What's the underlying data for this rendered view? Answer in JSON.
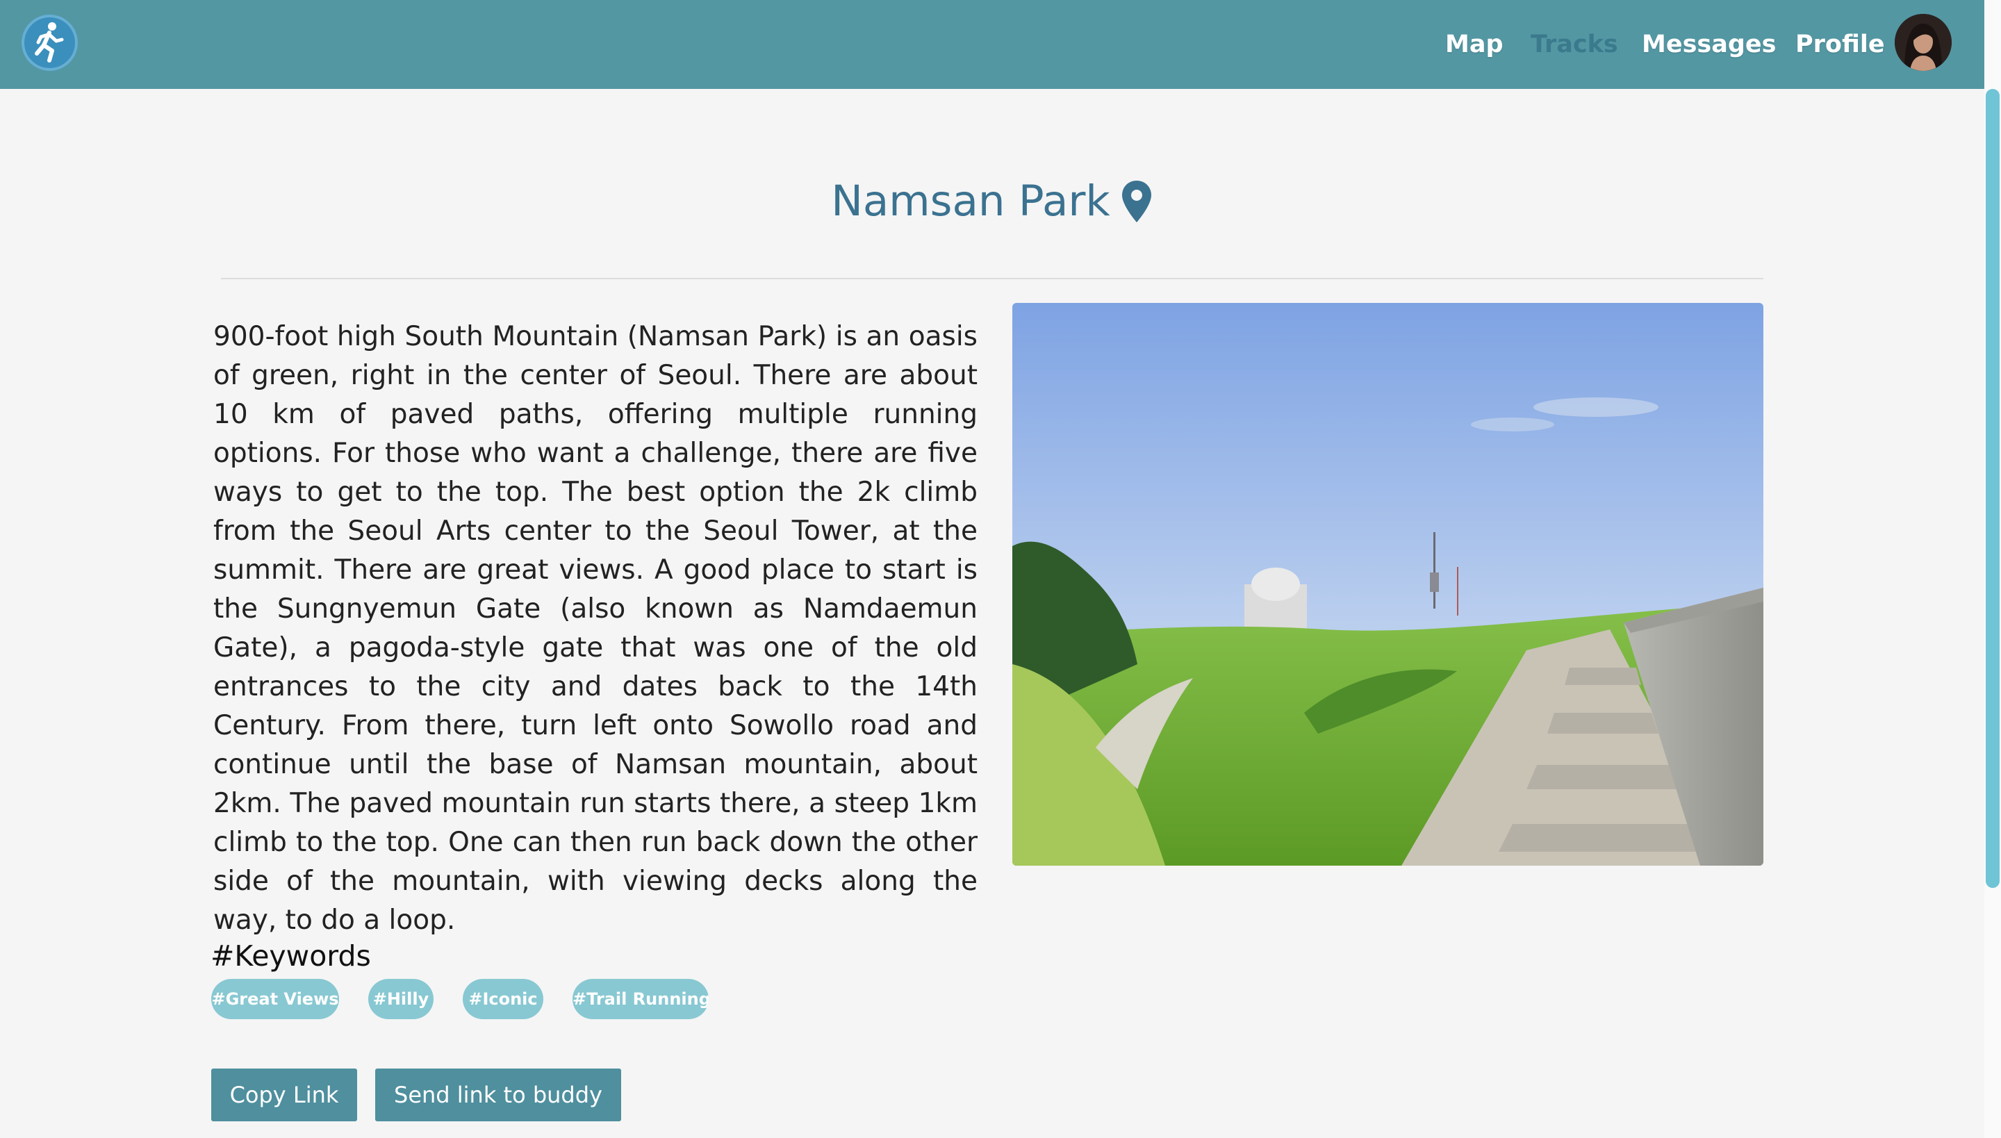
{
  "nav": {
    "links": [
      {
        "label": "Map"
      },
      {
        "label": "Tracks"
      },
      {
        "label": "Messages"
      },
      {
        "label": "Profile"
      }
    ],
    "active": "Tracks",
    "logo_icon": "runner-icon",
    "avatar_icon": "user-avatar"
  },
  "track": {
    "title": "Namsan Park",
    "title_icon": "map-pin-icon",
    "description": "900-foot high South Mountain (Namsan Park) is an oasis of green, right in the center of Seoul. There are about 10 km of paved paths, offering multiple running options. For those who want a challenge, there are five ways to get to the top. The best option the 2k climb from the Seoul Arts center to the Seoul Tower, at the summit. There are great views. A good place to start is the Sungnyemun Gate (also known as Namdaemun Gate), a pagoda-style gate that was one of the old entrances to the city and dates back to the 14th Century. From there, turn left onto Sowollo road and continue until the base of Namsan mountain, about 2km. The paved mountain run starts there, a steep 1km climb to the top. One can then run back down the other side of the mountain, with viewing decks along the way, to do a loop.",
    "photo_icon": "park-photo"
  },
  "keywords": {
    "heading": "#Keywords",
    "tags": [
      "#Great Views",
      "#Hilly",
      "#Iconic",
      "#Trail Running"
    ]
  },
  "actions": {
    "copy_label": "Copy Link",
    "send_label": "Send link to buddy"
  },
  "colors": {
    "navbar": "#5397a3",
    "title": "#3b7290",
    "tag": "#88c8d2",
    "button": "#4f8f9e",
    "active_nav": "#3b7a8d",
    "background": "#f5f5f5"
  }
}
